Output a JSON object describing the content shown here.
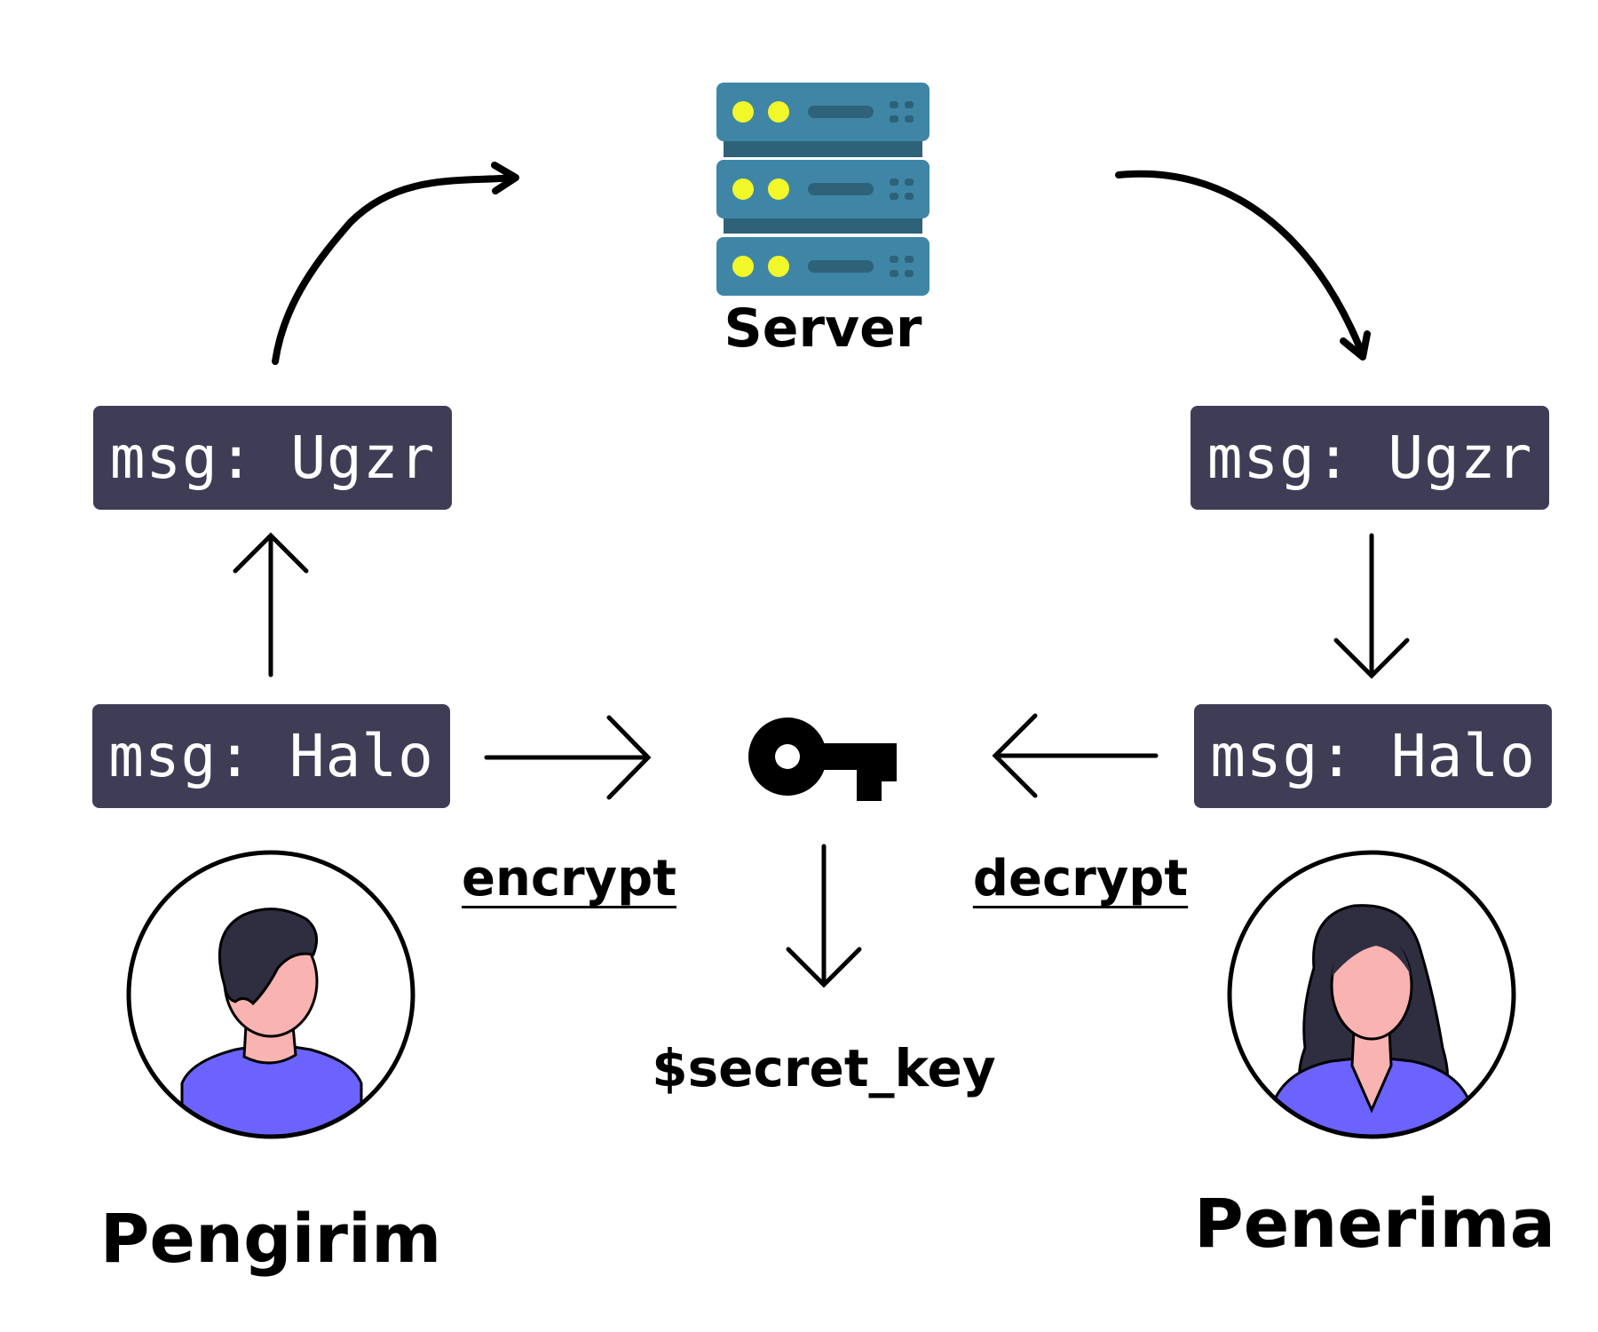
{
  "server": {
    "label": "Server",
    "icon": "server-rack-icon"
  },
  "sender": {
    "name": "Pengirim",
    "plain_msg": "msg: Halo",
    "cipher_msg": "msg: Ugzr",
    "avatar_icon": "male-user-avatar-icon"
  },
  "receiver": {
    "name": "Penerima",
    "plain_msg": "msg: Halo",
    "cipher_msg": "msg: Ugzr",
    "avatar_icon": "female-user-avatar-icon"
  },
  "key": {
    "label": "$secret_key",
    "icon": "key-icon"
  },
  "actions": {
    "encrypt": "encrypt",
    "decrypt": "decrypt"
  },
  "colors": {
    "msg_box": "#3f3d56",
    "server_body": "#3f86a6",
    "server_led": "#f2f72a",
    "shirt": "#6c63ff",
    "skin": "#f9b3b1",
    "hair": "#2f2e41"
  }
}
